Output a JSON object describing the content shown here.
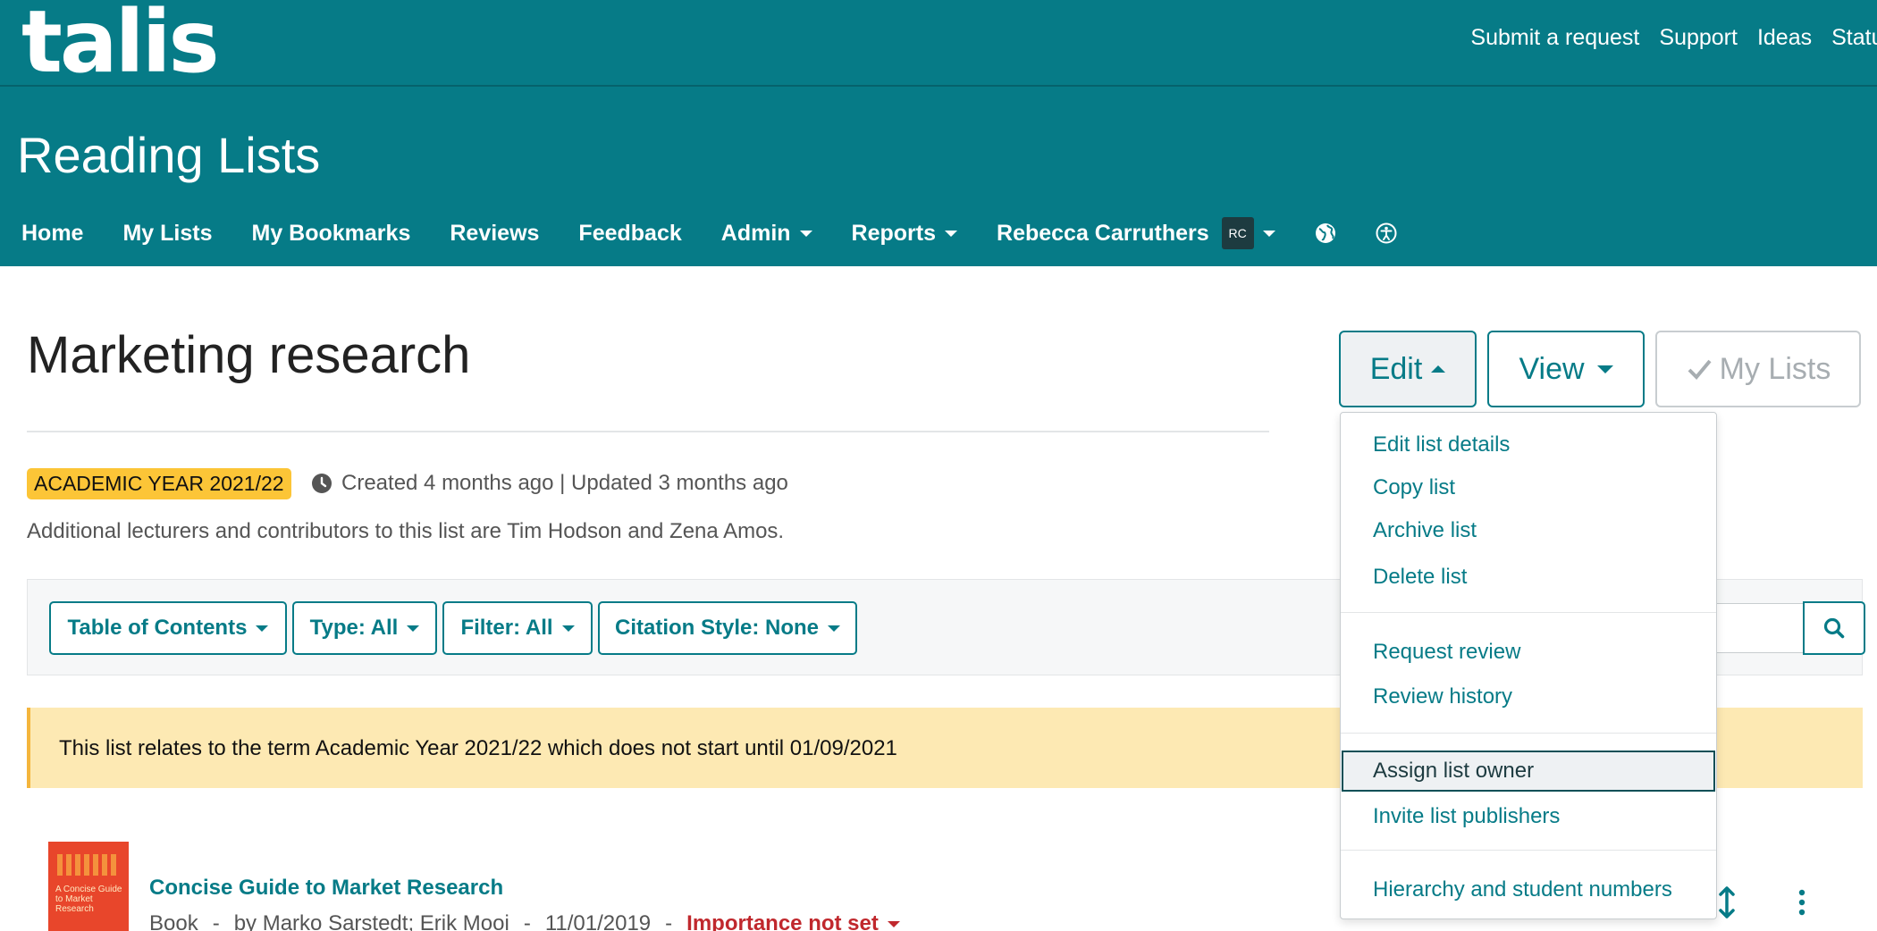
{
  "brand": {
    "logo": "talis"
  },
  "top_links": [
    "Submit a request",
    "Support",
    "Ideas",
    "Status"
  ],
  "app_title": "Reading Lists",
  "nav": {
    "home": "Home",
    "my_lists": "My Lists",
    "my_bookmarks": "My Bookmarks",
    "reviews": "Reviews",
    "feedback": "Feedback",
    "admin": "Admin",
    "reports": "Reports",
    "user_name": "Rebecca Carruthers",
    "user_initials": "RC"
  },
  "page": {
    "title": "Marketing research",
    "buttons": {
      "edit": "Edit",
      "view": "View",
      "my_lists": "My Lists"
    },
    "badge": "ACADEMIC YEAR 2021/22",
    "meta": "Created 4 months ago | Updated 3 months ago",
    "contributors": "Additional lecturers and contributors to this list are Tim Hodson and Zena Amos."
  },
  "toolbar": {
    "toc": "Table of Contents",
    "type": "Type: All",
    "filter": "Filter: All",
    "citation": "Citation Style: None"
  },
  "alert": "This list relates to the term Academic Year 2021/22 which does not start until 01/09/2021",
  "item": {
    "title": "Concise Guide to Market Research",
    "type": "Book",
    "authors": "by Marko Sarstedt; Erik Mooi",
    "date": "11/01/2019",
    "importance": "Importance not set",
    "cover_text": "A Concise Guide to Market Research"
  },
  "edit_menu": {
    "edit_details": "Edit list details",
    "copy": "Copy list",
    "archive": "Archive list",
    "delete": "Delete list",
    "request_review": "Request review",
    "review_history": "Review history",
    "assign_owner": "Assign list owner",
    "invite_publishers": "Invite list publishers",
    "hierarchy": "Hierarchy and student numbers"
  },
  "colors": {
    "brand_teal": "#067b87",
    "badge_yellow": "#fcc537",
    "alert_bg": "#fde9b3",
    "importance_red": "#c0282d"
  }
}
